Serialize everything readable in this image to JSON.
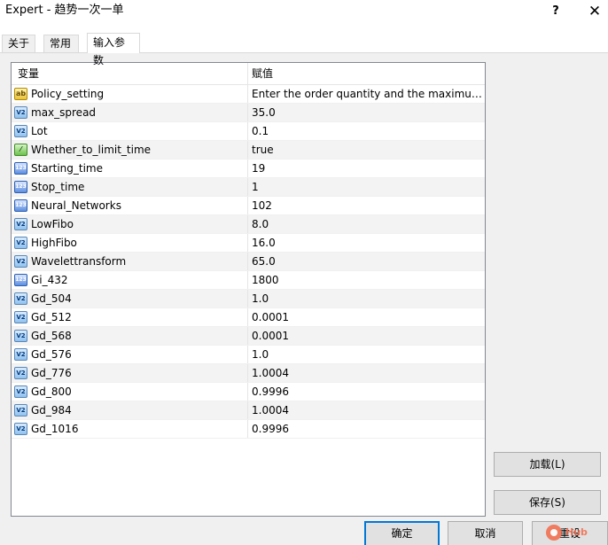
{
  "window": {
    "title": "Expert - 趋势一次一单",
    "help_label": "?",
    "close_label": "✕"
  },
  "tabs": [
    {
      "label": "关于",
      "active": false
    },
    {
      "label": "常用",
      "active": false
    },
    {
      "label": "输入参数",
      "active": true
    }
  ],
  "table": {
    "headers": {
      "name": "变量",
      "value": "赋值"
    },
    "rows": [
      {
        "name": "Policy_setting",
        "value": "Enter the order quantity and the maximum...",
        "icon": "ab"
      },
      {
        "name": "max_spread",
        "value": "35.0",
        "icon": "V2"
      },
      {
        "name": "Lot",
        "value": "0.1",
        "icon": "V2"
      },
      {
        "name": "Whether_to_limit_time",
        "value": "true",
        "icon": "bool"
      },
      {
        "name": "Starting_time",
        "value": "19",
        "icon": "123"
      },
      {
        "name": "Stop_time",
        "value": "1",
        "icon": "123"
      },
      {
        "name": "Neural_Networks",
        "value": "102",
        "icon": "123"
      },
      {
        "name": "LowFibo",
        "value": "8.0",
        "icon": "V2"
      },
      {
        "name": "HighFibo",
        "value": "16.0",
        "icon": "V2"
      },
      {
        "name": "Wavelettransform",
        "value": "65.0",
        "icon": "V2"
      },
      {
        "name": "Gi_432",
        "value": "1800",
        "icon": "123"
      },
      {
        "name": "Gd_504",
        "value": "1.0",
        "icon": "V2"
      },
      {
        "name": "Gd_512",
        "value": "0.0001",
        "icon": "V2"
      },
      {
        "name": "Gd_568",
        "value": "0.0001",
        "icon": "V2"
      },
      {
        "name": "Gd_576",
        "value": "1.0",
        "icon": "V2"
      },
      {
        "name": "Gd_776",
        "value": "1.0004",
        "icon": "V2"
      },
      {
        "name": "Gd_800",
        "value": "0.9996",
        "icon": "V2"
      },
      {
        "name": "Gd_984",
        "value": "1.0004",
        "icon": "V2"
      },
      {
        "name": "Gd_1016",
        "value": "0.9996",
        "icon": "V2"
      }
    ]
  },
  "buttons": {
    "load": "加载(L)",
    "save": "保存(S)",
    "ok": "确定",
    "cancel": "取消",
    "reset": "重设"
  },
  "watermark": {
    "text": "Hub"
  }
}
